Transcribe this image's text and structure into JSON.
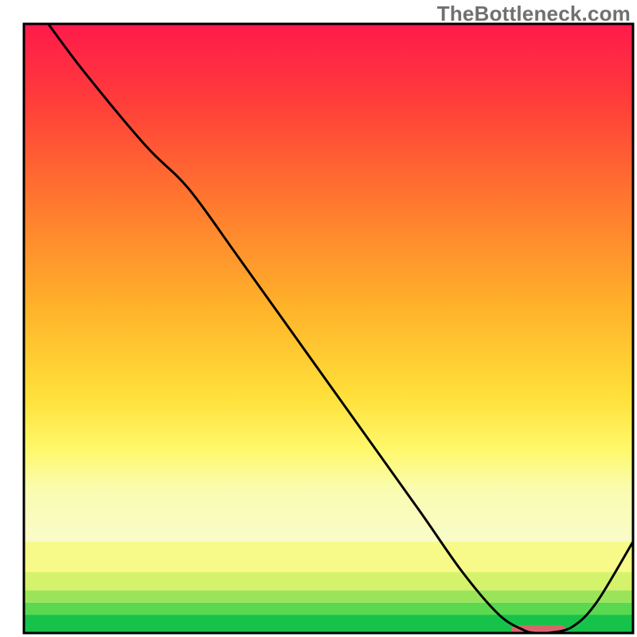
{
  "watermark": "TheBottleneck.com",
  "chart_data": {
    "type": "line",
    "title": "",
    "xlabel": "",
    "ylabel": "",
    "xlim": [
      0,
      100
    ],
    "ylim": [
      0,
      100
    ],
    "x": [
      4,
      10,
      20,
      27,
      35,
      45,
      55,
      65,
      72,
      78,
      82,
      84,
      86,
      90,
      94,
      100
    ],
    "values": [
      100,
      92,
      80,
      73,
      62,
      48,
      34,
      20,
      10,
      3,
      0.5,
      0,
      0,
      1,
      5,
      15
    ],
    "optimal_marker": {
      "x_start": 80,
      "x_end": 89,
      "y": 0
    },
    "background_bands": [
      {
        "y": 0,
        "h": 3,
        "color": "#17c24b"
      },
      {
        "y": 3,
        "h": 2,
        "color": "#5ad84f"
      },
      {
        "y": 5,
        "h": 2,
        "color": "#9be45a"
      },
      {
        "y": 7,
        "h": 3,
        "color": "#d5f26c"
      },
      {
        "y": 10,
        "h": 5,
        "color": "#f7fa88"
      },
      {
        "y": 15,
        "h": 85,
        "color": "gradient"
      }
    ],
    "gradient_stops": [
      {
        "offset": 0.0,
        "color": "#ff1a4b"
      },
      {
        "offset": 0.15,
        "color": "#ff3d3a"
      },
      {
        "offset": 0.35,
        "color": "#ff7a2e"
      },
      {
        "offset": 0.55,
        "color": "#ffb32a"
      },
      {
        "offset": 0.72,
        "color": "#ffe03a"
      },
      {
        "offset": 0.82,
        "color": "#fff86a"
      },
      {
        "offset": 0.9,
        "color": "#f9fcb0"
      },
      {
        "offset": 1.0,
        "color": "#f9fcc8"
      }
    ],
    "curve_color": "#000000",
    "curve_width": 3,
    "frame_color": "#000000",
    "frame_width": 3,
    "marker_color": "#d9656b"
  }
}
